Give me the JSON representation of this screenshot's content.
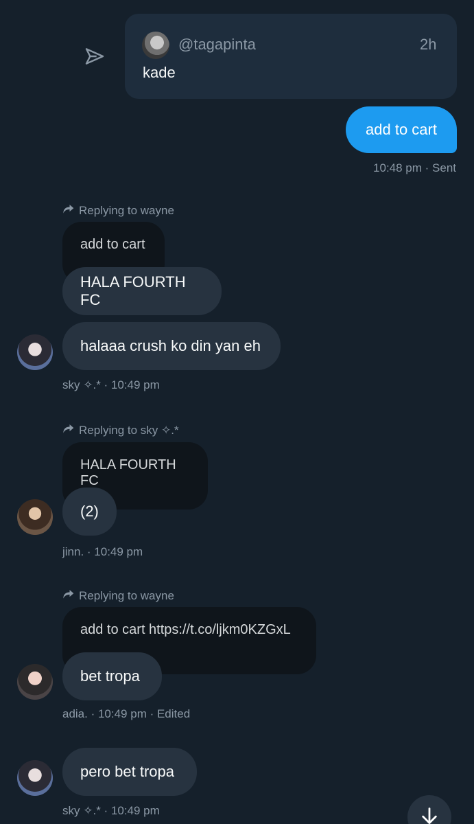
{
  "quoted_tweet": {
    "handle": "@tagapinta",
    "time": "2h",
    "text": "kade"
  },
  "sent_message": {
    "text": "add to cart",
    "meta": "10:48 pm · Sent"
  },
  "messages": [
    {
      "reply_label": "Replying to wayne",
      "quoted_text": "add to cart",
      "bubbles": [
        "HALA FOURTH FC",
        "halaaa crush ko din yan eh"
      ],
      "meta": "sky ✧.* · 10:49 pm"
    },
    {
      "reply_label": "Replying to sky ✧.*",
      "quoted_text": "HALA FOURTH FC",
      "bubbles": [
        "(2)"
      ],
      "meta": "jinn. · 10:49 pm"
    },
    {
      "reply_label": "Replying to wayne",
      "quoted_text": "add to cart https://t.co/ljkm0KZGxL",
      "bubbles": [
        "bet tropa"
      ],
      "meta": "adia. · 10:49 pm · Edited"
    },
    {
      "bubbles": [
        "pero bet tropa"
      ],
      "meta": "sky ✧.* · 10:49 pm"
    }
  ],
  "colors": {
    "background": "#15202b",
    "accent": "#1d9bf0",
    "bubble": "#273340",
    "quoted_bubble": "#0f151b",
    "muted_text": "#8b98a5"
  }
}
